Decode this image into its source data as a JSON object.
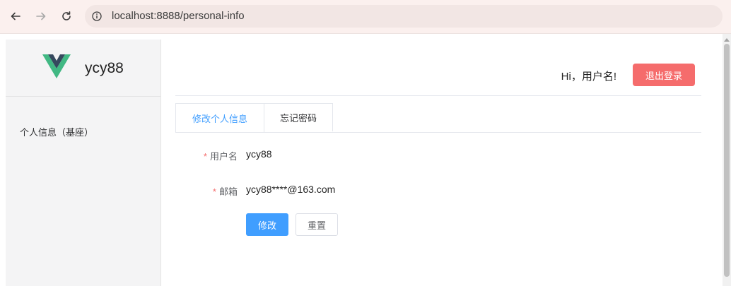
{
  "browser": {
    "url": "localhost:8888/personal-info"
  },
  "sidebar": {
    "brand": "ycy88",
    "items": [
      {
        "label": "个人信息（基座）"
      }
    ]
  },
  "header": {
    "greeting": "Hi，用户名!",
    "logout_label": "退出登录"
  },
  "tabs": [
    {
      "label": "修改个人信息",
      "active": true
    },
    {
      "label": "忘记密码",
      "active": false
    }
  ],
  "form": {
    "username_label": "用户名",
    "username_value": "ycy88",
    "email_label": "邮箱",
    "email_value": "ycy88****@163.com",
    "required_mark": "*",
    "submit_label": "修改",
    "reset_label": "重置"
  },
  "colors": {
    "primary": "#409eff",
    "danger": "#f56c6c"
  }
}
